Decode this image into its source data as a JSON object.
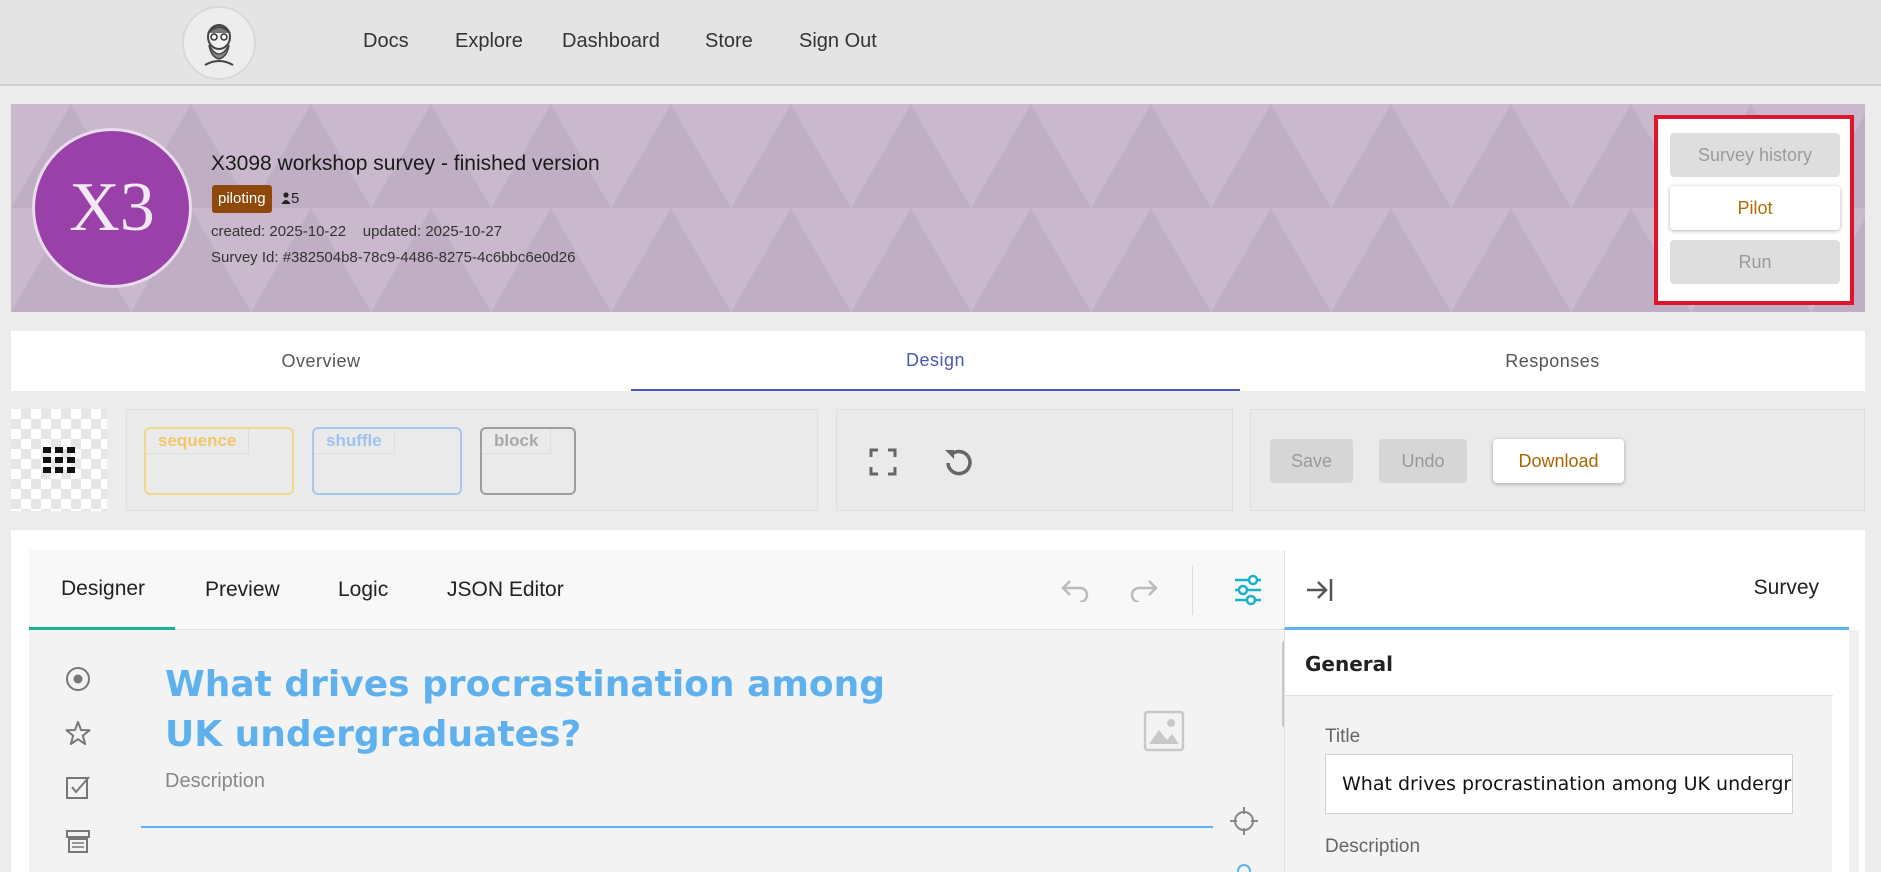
{
  "nav": {
    "links": [
      "Docs",
      "Explore",
      "Dashboard",
      "Store",
      "Sign Out"
    ]
  },
  "banner": {
    "avatar_text": "X3",
    "title": "X3098 workshop survey - finished version",
    "status": "piloting",
    "participants": "5",
    "created": "created: 2025-10-22",
    "updated": "updated: 2025-10-27",
    "survey_id": "Survey Id: #382504b8-78c9-4486-8275-4c6bbc6e0d26",
    "actions": {
      "history": "Survey history",
      "pilot": "Pilot",
      "run": "Run"
    }
  },
  "tabs": [
    "Overview",
    "Design",
    "Responses"
  ],
  "active_tab": "Design",
  "toolbar": {
    "controls": [
      "sequence",
      "shuffle",
      "block"
    ],
    "save": "Save",
    "undo": "Undo",
    "download": "Download"
  },
  "designer": {
    "tabs": [
      "Designer",
      "Preview",
      "Logic",
      "JSON Editor"
    ],
    "active_tab": "Designer",
    "question_title": "What drives procrastination among UK undergraduates?",
    "question_description": "Description",
    "panel_title": "Survey",
    "section": "General",
    "title_label": "Title",
    "title_value": "What drives procrastination among UK undergraduates?",
    "description_label": "Description"
  },
  "colors": {
    "banner": "#c6b4c9",
    "avatar": "#9a40a9",
    "badge": "#8f4a0b",
    "highlight": "#e0152b",
    "accent": "#5fb1ee",
    "tab_active": "#4a56b8"
  }
}
